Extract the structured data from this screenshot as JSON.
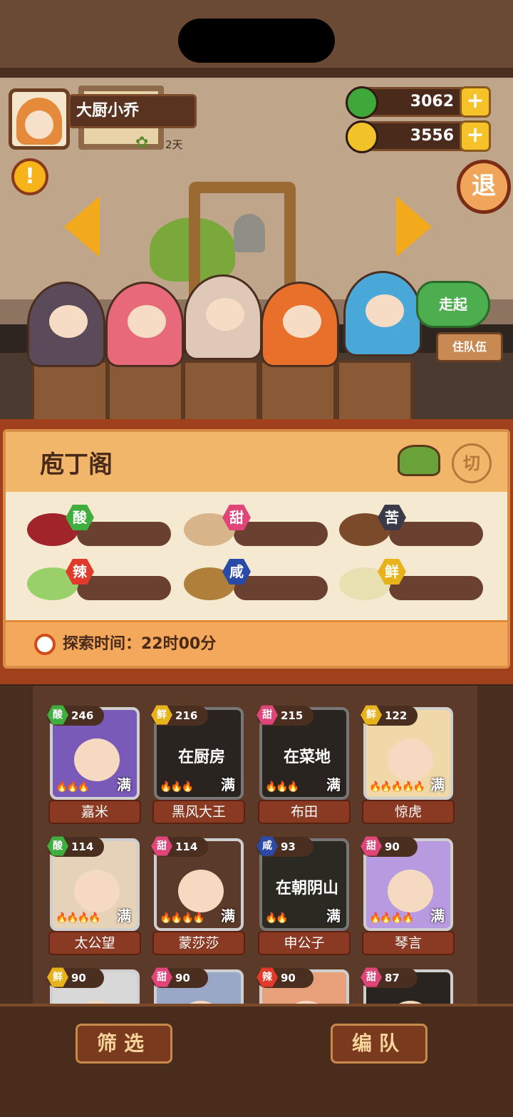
{
  "player": {
    "name": "大厨小乔",
    "days": "2天"
  },
  "currency": {
    "jade": "3062",
    "coin": "3556"
  },
  "buttons": {
    "exit": "退",
    "go": "走起",
    "team_sign": "住队伍",
    "alert": "!",
    "plus": "+"
  },
  "panel": {
    "title": "庖丁阁",
    "cut_label": "切",
    "flavors": [
      {
        "label": "酸",
        "color": "#3fae3f"
      },
      {
        "label": "甜",
        "color": "#e0457a"
      },
      {
        "label": "苦",
        "color": "#3a3a48"
      },
      {
        "label": "辣",
        "color": "#e23a2a"
      },
      {
        "label": "咸",
        "color": "#2a4aa8"
      },
      {
        "label": "鲜",
        "color": "#e8b21a"
      }
    ],
    "explore_label": "探索时间：22时00分"
  },
  "roster": [
    {
      "flavor": "酸",
      "flavor_color": "#3fae3f",
      "level": "246",
      "name": "嘉米",
      "status": "",
      "full": "满",
      "bg": "#7a5ab8",
      "flames": 3
    },
    {
      "flavor": "鲜",
      "flavor_color": "#e8b21a",
      "level": "216",
      "name": "黑风大王",
      "status": "在厨房",
      "full": "满",
      "bg": "#2a2420",
      "flames": 3
    },
    {
      "flavor": "甜",
      "flavor_color": "#e0457a",
      "level": "215",
      "name": "布田",
      "status": "在菜地",
      "full": "满",
      "bg": "#2a2420",
      "flames": 3
    },
    {
      "flavor": "鲜",
      "flavor_color": "#e8b21a",
      "level": "122",
      "name": "惊虎",
      "status": "",
      "full": "满",
      "bg": "#f0d8a8",
      "flames": 5
    },
    {
      "flavor": "酸",
      "flavor_color": "#3fae3f",
      "level": "114",
      "name": "太公望",
      "status": "",
      "full": "满",
      "bg": "#e6d2b8",
      "flames": 4
    },
    {
      "flavor": "甜",
      "flavor_color": "#e0457a",
      "level": "114",
      "name": "蒙莎莎",
      "status": "",
      "full": "满",
      "bg": "#5a3a2a",
      "flames": 4
    },
    {
      "flavor": "咸",
      "flavor_color": "#2a4aa8",
      "level": "93",
      "name": "申公子",
      "status": "在朝阴山",
      "full": "满",
      "bg": "#2a2a22",
      "flames": 2
    },
    {
      "flavor": "甜",
      "flavor_color": "#e0457a",
      "level": "90",
      "name": "琴言",
      "status": "",
      "full": "满",
      "bg": "#b89ae0",
      "flames": 4
    },
    {
      "flavor": "鲜",
      "flavor_color": "#e8b21a",
      "level": "90",
      "name": "",
      "status": "",
      "full": "",
      "bg": "#d8d8d8",
      "flames": 0
    },
    {
      "flavor": "甜",
      "flavor_color": "#e0457a",
      "level": "90",
      "name": "",
      "status": "",
      "full": "",
      "bg": "#9aa8c8",
      "flames": 0
    },
    {
      "flavor": "辣",
      "flavor_color": "#e23a2a",
      "level": "90",
      "name": "",
      "status": "",
      "full": "",
      "bg": "#e8a07a",
      "flames": 0
    },
    {
      "flavor": "甜",
      "flavor_color": "#e0457a",
      "level": "87",
      "name": "",
      "status": "",
      "full": "",
      "bg": "#2a2420",
      "flames": 0
    }
  ],
  "bottom": {
    "filter": "筛选",
    "team": "编队"
  }
}
